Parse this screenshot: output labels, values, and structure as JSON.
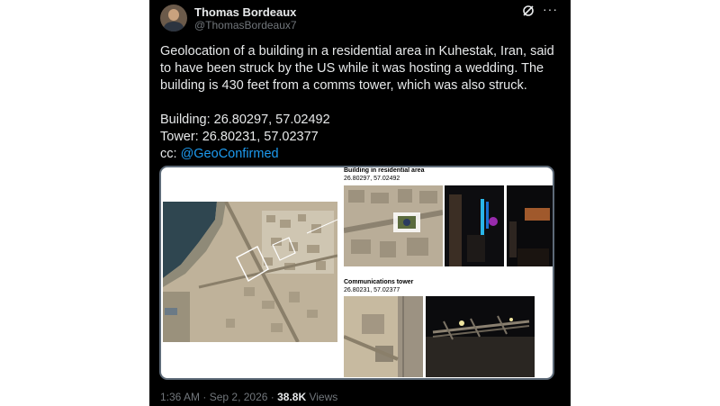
{
  "author": {
    "name": "Thomas Bordeaux",
    "handle": "@ThomasBordeaux7"
  },
  "tweet": {
    "text_line1": "Geolocation of a building in a residential area in Kuhestak, Iran, said to have been struck by the US while it was hosting a wedding. The building is 430 feet from a comms tower, which was also struck.",
    "building_coords": "Building: 26.80297, 57.02492",
    "tower_coords": "Tower: 26.80231, 57.02377",
    "cc_prefix": "cc: ",
    "cc_mention": "@GeoConfirmed"
  },
  "media": {
    "building_label": "Building in residential area",
    "building_coords": "26.80297, 57.02492",
    "tower_label": "Communications tower",
    "tower_coords": "26.80231, 57.02377"
  },
  "footer": {
    "time": "1:36 AM",
    "separator": " · ",
    "date": "Sep 2, 2026",
    "views_count": "38.8K",
    "views_label": " Views"
  },
  "icons": {
    "grok": "grok-icon",
    "more": "more-options-icon"
  },
  "colors": {
    "background": "#000000",
    "text": "#e7e9ea",
    "secondary": "#71767b",
    "link": "#1d9bf0"
  }
}
